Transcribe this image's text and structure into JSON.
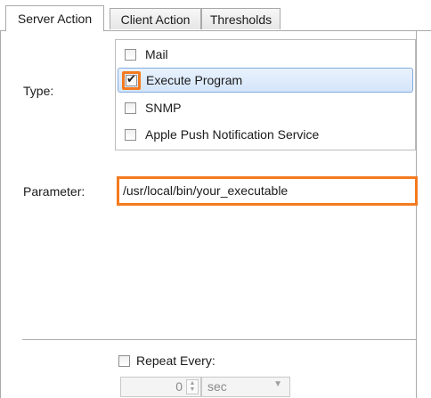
{
  "tabs": [
    {
      "label": "Server Action",
      "active": true
    },
    {
      "label": "Client Action",
      "active": false
    },
    {
      "label": "Thresholds",
      "active": false
    }
  ],
  "type": {
    "label": "Type:",
    "options": [
      {
        "label": "Mail",
        "checked": false
      },
      {
        "label": "Execute Program",
        "checked": true,
        "selected": true
      },
      {
        "label": "SNMP",
        "checked": false
      },
      {
        "label": "Apple Push Notification Service",
        "checked": false
      }
    ]
  },
  "parameter": {
    "label": "Parameter:",
    "value": "/usr/local/bin/your_executable"
  },
  "repeat": {
    "label": "Repeat Every:",
    "checked": false,
    "value": "0",
    "unit": "sec"
  },
  "colors": {
    "highlight": "#f47a1f",
    "selection": "#d4e5fa"
  }
}
